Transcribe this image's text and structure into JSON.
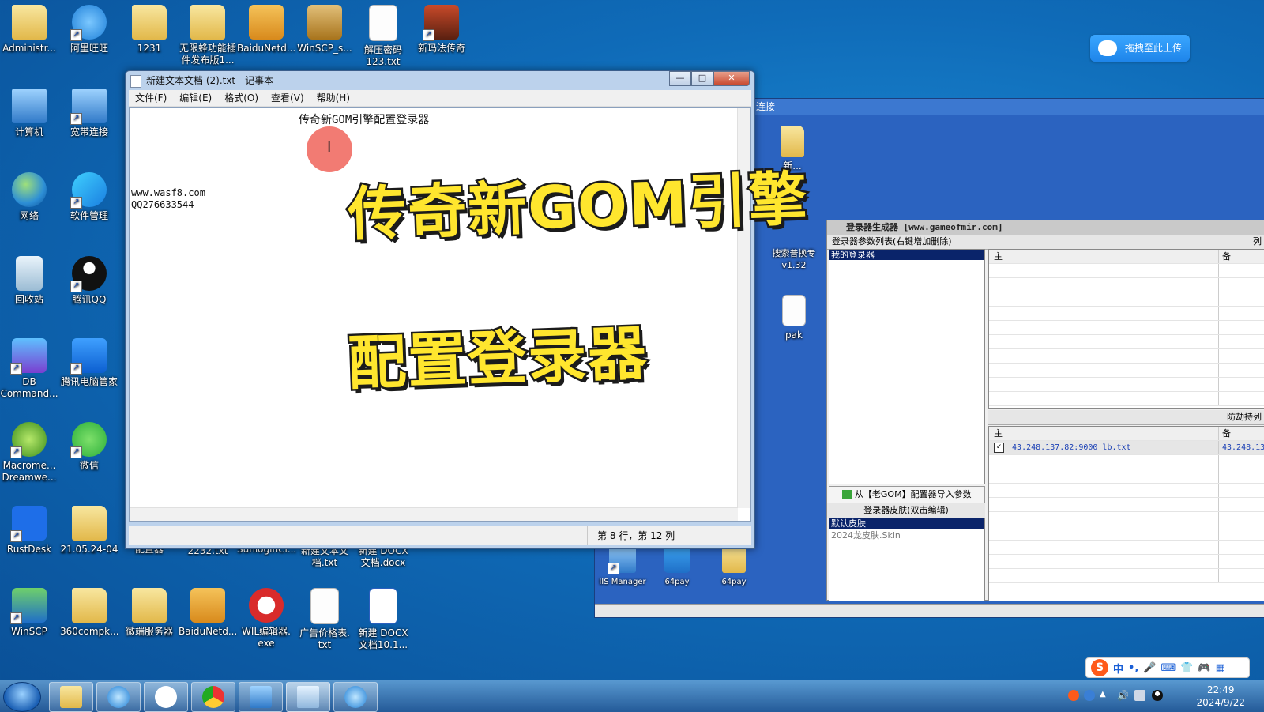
{
  "desktop_icons": [
    {
      "label": "Administr..."
    },
    {
      "label": "阿里旺旺"
    },
    {
      "label": "1231"
    },
    {
      "label": "无限蜂功能插\n件发布版1..."
    },
    {
      "label": "BaiduNetd..."
    },
    {
      "label": "WinSCP_s..."
    },
    {
      "label": "解压密码\n123.txt"
    },
    {
      "label": "新玛法传奇"
    },
    {
      "label": "计算机"
    },
    {
      "label": "宽带连接"
    },
    {
      "label": "网络"
    },
    {
      "label": "软件管理"
    },
    {
      "label": "回收站"
    },
    {
      "label": "腾讯QQ"
    },
    {
      "label": "DB\nCommand..."
    },
    {
      "label": "腾讯电脑管家"
    },
    {
      "label": "Macrome...\nDreamwe..."
    },
    {
      "label": "微信"
    },
    {
      "label": "RustDesk"
    },
    {
      "label": "21.05.24-04"
    },
    {
      "label": "配置器"
    },
    {
      "label": "2232.txt"
    },
    {
      "label": "SunloginCl..."
    },
    {
      "label": "新建文本文\n档.txt"
    },
    {
      "label": "新建 DOCX\n文档.docx"
    },
    {
      "label": "WinSCP"
    },
    {
      "label": "360compk..."
    },
    {
      "label": "微端服务器"
    },
    {
      "label": "BaiduNetd..."
    },
    {
      "label": "WIL编辑器.\nexe"
    },
    {
      "label": "广告价格表.\ntxt"
    },
    {
      "label": "新建 DOCX\n文档10.1..."
    }
  ],
  "notepad": {
    "title": "新建文本文档 (2).txt - 记事本",
    "menu": [
      "文件(F)",
      "编辑(E)",
      "格式(O)",
      "查看(V)",
      "帮助(H)"
    ],
    "lines": {
      "header": "传奇新GOM引擎配置登录器",
      "url": "www.wasf8.com",
      "qq": "QQ276633544"
    },
    "status": "第 8 行，第 12 列"
  },
  "overlay": {
    "line1": "传奇新GOM引擎",
    "line2": "配置登录器"
  },
  "upload_button": "拖拽至此上传",
  "background_app": {
    "partial_title": "连接",
    "icons": [
      {
        "label": "新..."
      },
      {
        "label": "搜索普换专\nv1.32"
      },
      {
        "label": "pak"
      },
      {
        "label": "IIS Manager"
      },
      {
        "label": "64pay"
      },
      {
        "label": "64pay"
      }
    ],
    "generator": {
      "title": "登录器生成器 [www.gameofmir.com]",
      "param_list_header": "登录器参数列表(右键增加删除)",
      "param_selected": "我的登录器",
      "import_button": "从【老GOM】配置器导入参数",
      "skin_header": "登录器皮肤(双击编辑)",
      "skins": [
        "默认皮肤",
        "2024龙皮肤.Skin"
      ],
      "right_header_top": "列",
      "grid1_cols": [
        "主",
        "备"
      ],
      "anti_header": "防劫持列",
      "grid2_cols": [
        "主",
        "备"
      ],
      "grid2_row": {
        "main": "43.248.137.82:9000 lb.txt",
        "backup": "43.248.13"
      }
    }
  },
  "taskbar": {
    "time": "22:49",
    "date": "2024/9/22",
    "ime_label": "中"
  },
  "colors": {
    "accent": "#1e85ea",
    "overlay_fill": "#ffe62e"
  }
}
